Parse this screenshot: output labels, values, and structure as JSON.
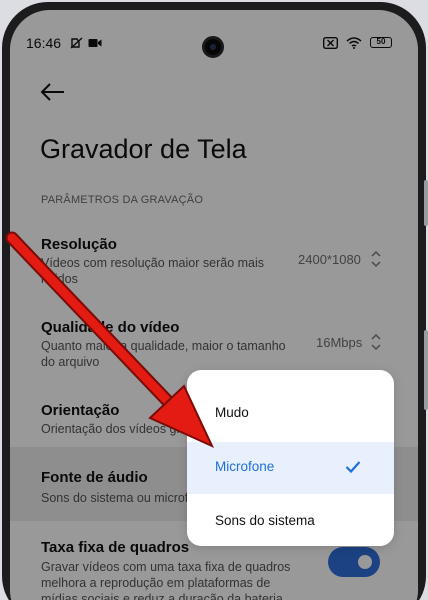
{
  "status_bar": {
    "time": "16:46",
    "battery": "50"
  },
  "header": {
    "title": "Gravador de Tela"
  },
  "section_label": "PARÂMETROS DA GRAVAÇÃO",
  "settings": [
    {
      "title": "Resolução",
      "subtitle": "Vídeos com resolução maior serão mais nítidos",
      "value": "2400*1080"
    },
    {
      "title": "Qualidade do vídeo",
      "subtitle": "Quanto maior a qualidade, maior o tamanho do arquivo",
      "value": "16Mbps"
    },
    {
      "title": "Orientação",
      "subtitle": "Orientação dos vídeos gravados"
    },
    {
      "title": "Fonte de áudio",
      "subtitle": "Sons do sistema ou microfone"
    },
    {
      "title": "Taxa fixa de quadros",
      "subtitle": "Gravar vídeos com uma taxa fixa de quadros melhora a reprodução em plataformas de mídias sociais e reduz a duração da bateria.",
      "toggle_on": true
    }
  ],
  "dropdown": {
    "options": [
      "Mudo",
      "Microfone",
      "Sons do sistema"
    ],
    "selected": "Microfone"
  },
  "colors": {
    "accent": "#1e6fd8",
    "toggle": "#2f6fda",
    "arrow": "#e31b12"
  },
  "icons": [
    "back-arrow-icon",
    "mute-icon",
    "video-camera-icon",
    "close-box-icon",
    "wifi-icon",
    "battery-icon",
    "up-down-chevron-icon",
    "checkmark-icon"
  ]
}
